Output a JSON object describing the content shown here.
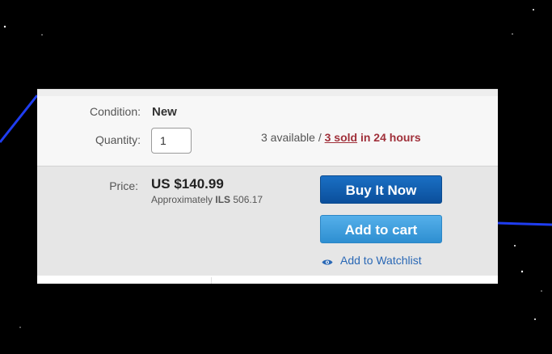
{
  "listing": {
    "condition_label": "Condition:",
    "condition_value": "New",
    "quantity_label": "Quantity:",
    "quantity_value": "1",
    "available_text": "3 available / ",
    "sold_link": "3 sold",
    "sold_suffix": " in 24 hours"
  },
  "pricing": {
    "price_label": "Price:",
    "price_value": "US $140.99",
    "approx_prefix": "Approximately ",
    "approx_currency": "ILS",
    "approx_amount": " 506.17"
  },
  "actions": {
    "buy_now_label": "Buy It Now",
    "add_to_cart_label": "Add to cart",
    "watchlist_label": "Add to Watchlist",
    "watchlist_icon": "eye-icon"
  },
  "colors": {
    "buy_now": "#0b4f9b",
    "add_to_cart": "#2e8fd1",
    "sold_text": "#a0303a",
    "link": "#2a68b5"
  }
}
